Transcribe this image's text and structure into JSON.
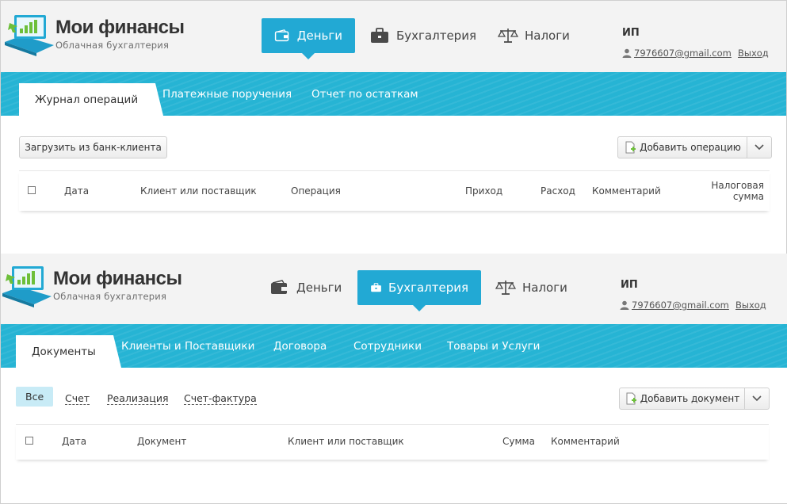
{
  "app": {
    "title": "Мои финансы",
    "subtitle": "Облачная бухгалтерия"
  },
  "nav": {
    "money": "Деньги",
    "accounting": "Бухгалтерия",
    "taxes": "Налоги"
  },
  "user": {
    "org": "ИП",
    "email": "7976607@gmail.com",
    "logout": "Выход"
  },
  "money_screen": {
    "tabs": [
      "Журнал операций",
      "Платежные поручения",
      "Отчет по остаткам"
    ],
    "active_tab": "Журнал операций",
    "load_button": "Загрузить из банк-клиента",
    "add_button": "Добавить операцию",
    "columns": {
      "date": "Дата",
      "client": "Клиент или поставщик",
      "operation": "Операция",
      "income": "Приход",
      "expense": "Расход",
      "comment": "Комментарий",
      "tax_line1": "Налоговая",
      "tax_line2": "сумма"
    }
  },
  "accounting_screen": {
    "tabs": [
      "Документы",
      "Клиенты и Поставщики",
      "Договора",
      "Сотрудники",
      "Товары и Услуги"
    ],
    "active_tab": "Документы",
    "filters": [
      "Все",
      "Счет",
      "Реализация",
      "Счет-фактура"
    ],
    "active_filter": "Все",
    "add_button": "Добавить документ",
    "columns": {
      "date": "Дата",
      "document": "Документ",
      "client": "Клиент или поставщик",
      "sum": "Сумма",
      "comment": "Комментарий"
    }
  },
  "colors": {
    "accent": "#22a9d4",
    "tabbar": "#26b4d4",
    "active_filter_bg": "#c8ebf6"
  },
  "icons": {
    "logo": "laptop-chart-icon",
    "money": "wallet-icon",
    "accounting": "briefcase-icon",
    "taxes": "scales-icon",
    "user": "user-icon",
    "add": "add-document-icon",
    "caret": "chevron-down-icon"
  }
}
